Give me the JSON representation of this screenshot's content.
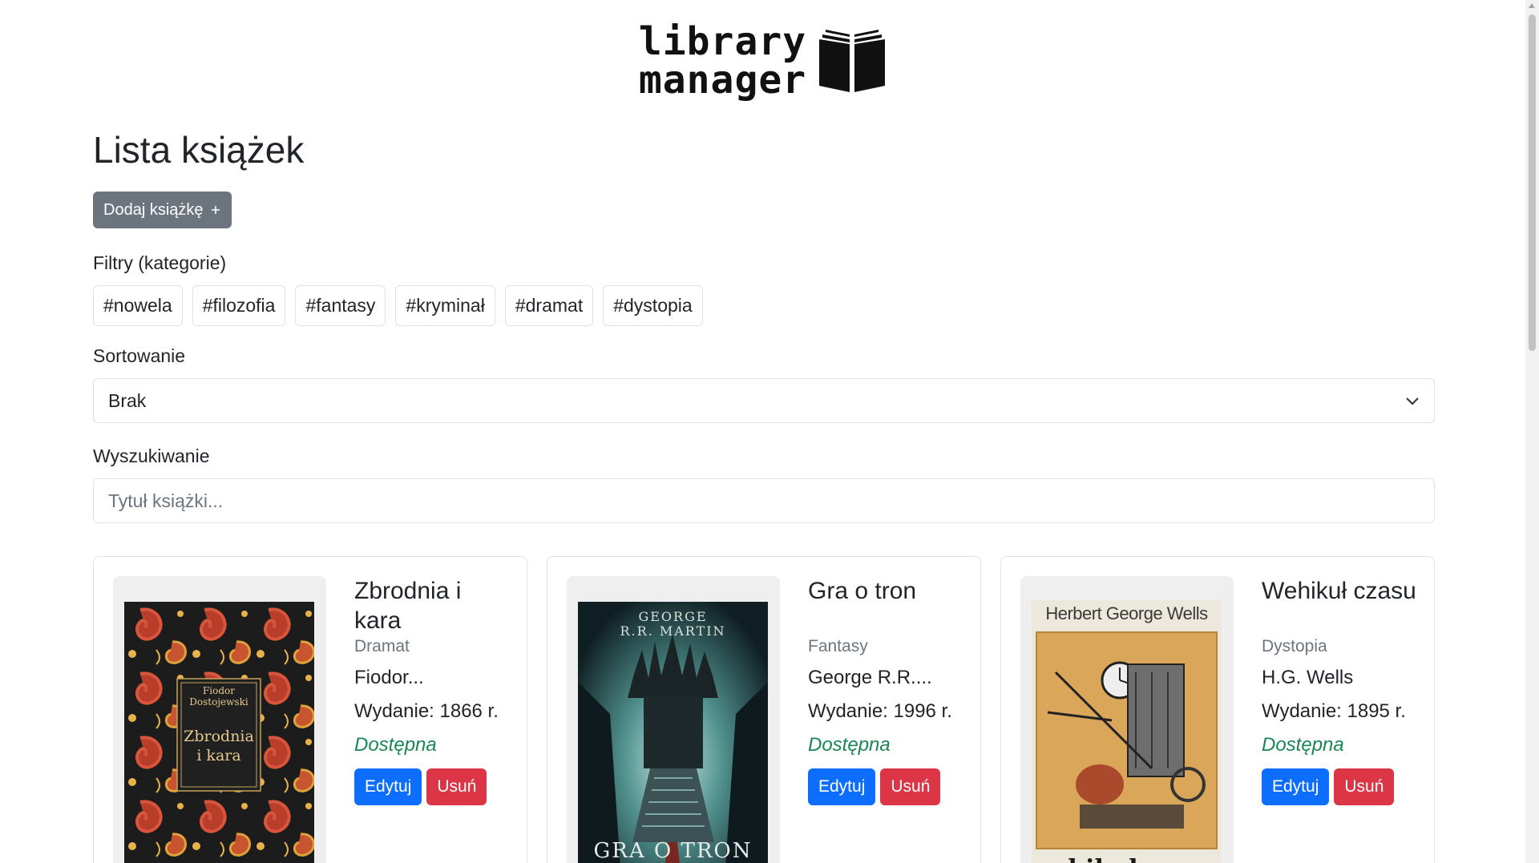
{
  "header": {
    "logo_line1": "library",
    "logo_line2": "manager",
    "logo_icon": "open-book-icon"
  },
  "page": {
    "title": "Lista książek",
    "add_button": "Dodaj książkę",
    "add_button_icon": "plus-icon"
  },
  "filters": {
    "label": "Filtry (kategorie)",
    "tags": [
      "#nowela",
      "#filozofia",
      "#fantasy",
      "#kryminał",
      "#dramat",
      "#dystopia"
    ]
  },
  "sorting": {
    "label": "Sortowanie",
    "selected": "Brak",
    "icon": "chevron-down-icon"
  },
  "search": {
    "label": "Wyszukiwanie",
    "placeholder": "Tytuł książki..."
  },
  "books": [
    {
      "title": "Zbrodnia i kara",
      "category": "Dramat",
      "author": "Fiodor...",
      "year": "Wydanie: 1866 r.",
      "status": "Dostępna",
      "edit_label": "Edytuj",
      "delete_label": "Usuń",
      "cover_author_line1": "Fiodor",
      "cover_author_line2": "Dostojewski",
      "cover_title_line1": "Zbrodnia",
      "cover_title_line2": "i kara"
    },
    {
      "title": "Gra o tron",
      "category": "Fantasy",
      "author": "George R.R....",
      "year": "Wydanie: 1996 r.",
      "status": "Dostępna",
      "edit_label": "Edytuj",
      "delete_label": "Usuń",
      "cover_author_line1": "GEORGE",
      "cover_author_line2": "R.R. MARTIN",
      "cover_title_line1": "GRA O TRON",
      "cover_title_line2": ""
    },
    {
      "title": "Wehikuł czasu",
      "category": "Dystopia",
      "author": "H.G. Wells",
      "year": "Wydanie: 1895 r.",
      "status": "Dostępna",
      "edit_label": "Edytuj",
      "delete_label": "Usuń",
      "cover_author_line1": "Herbert George Wells",
      "cover_author_line2": "",
      "cover_title_line1": "wehikuł czasu",
      "cover_title_line2": ""
    }
  ],
  "colors": {
    "primary": "#0d6efd",
    "danger": "#dc3545",
    "secondary": "#6c757d",
    "success": "#198754"
  }
}
